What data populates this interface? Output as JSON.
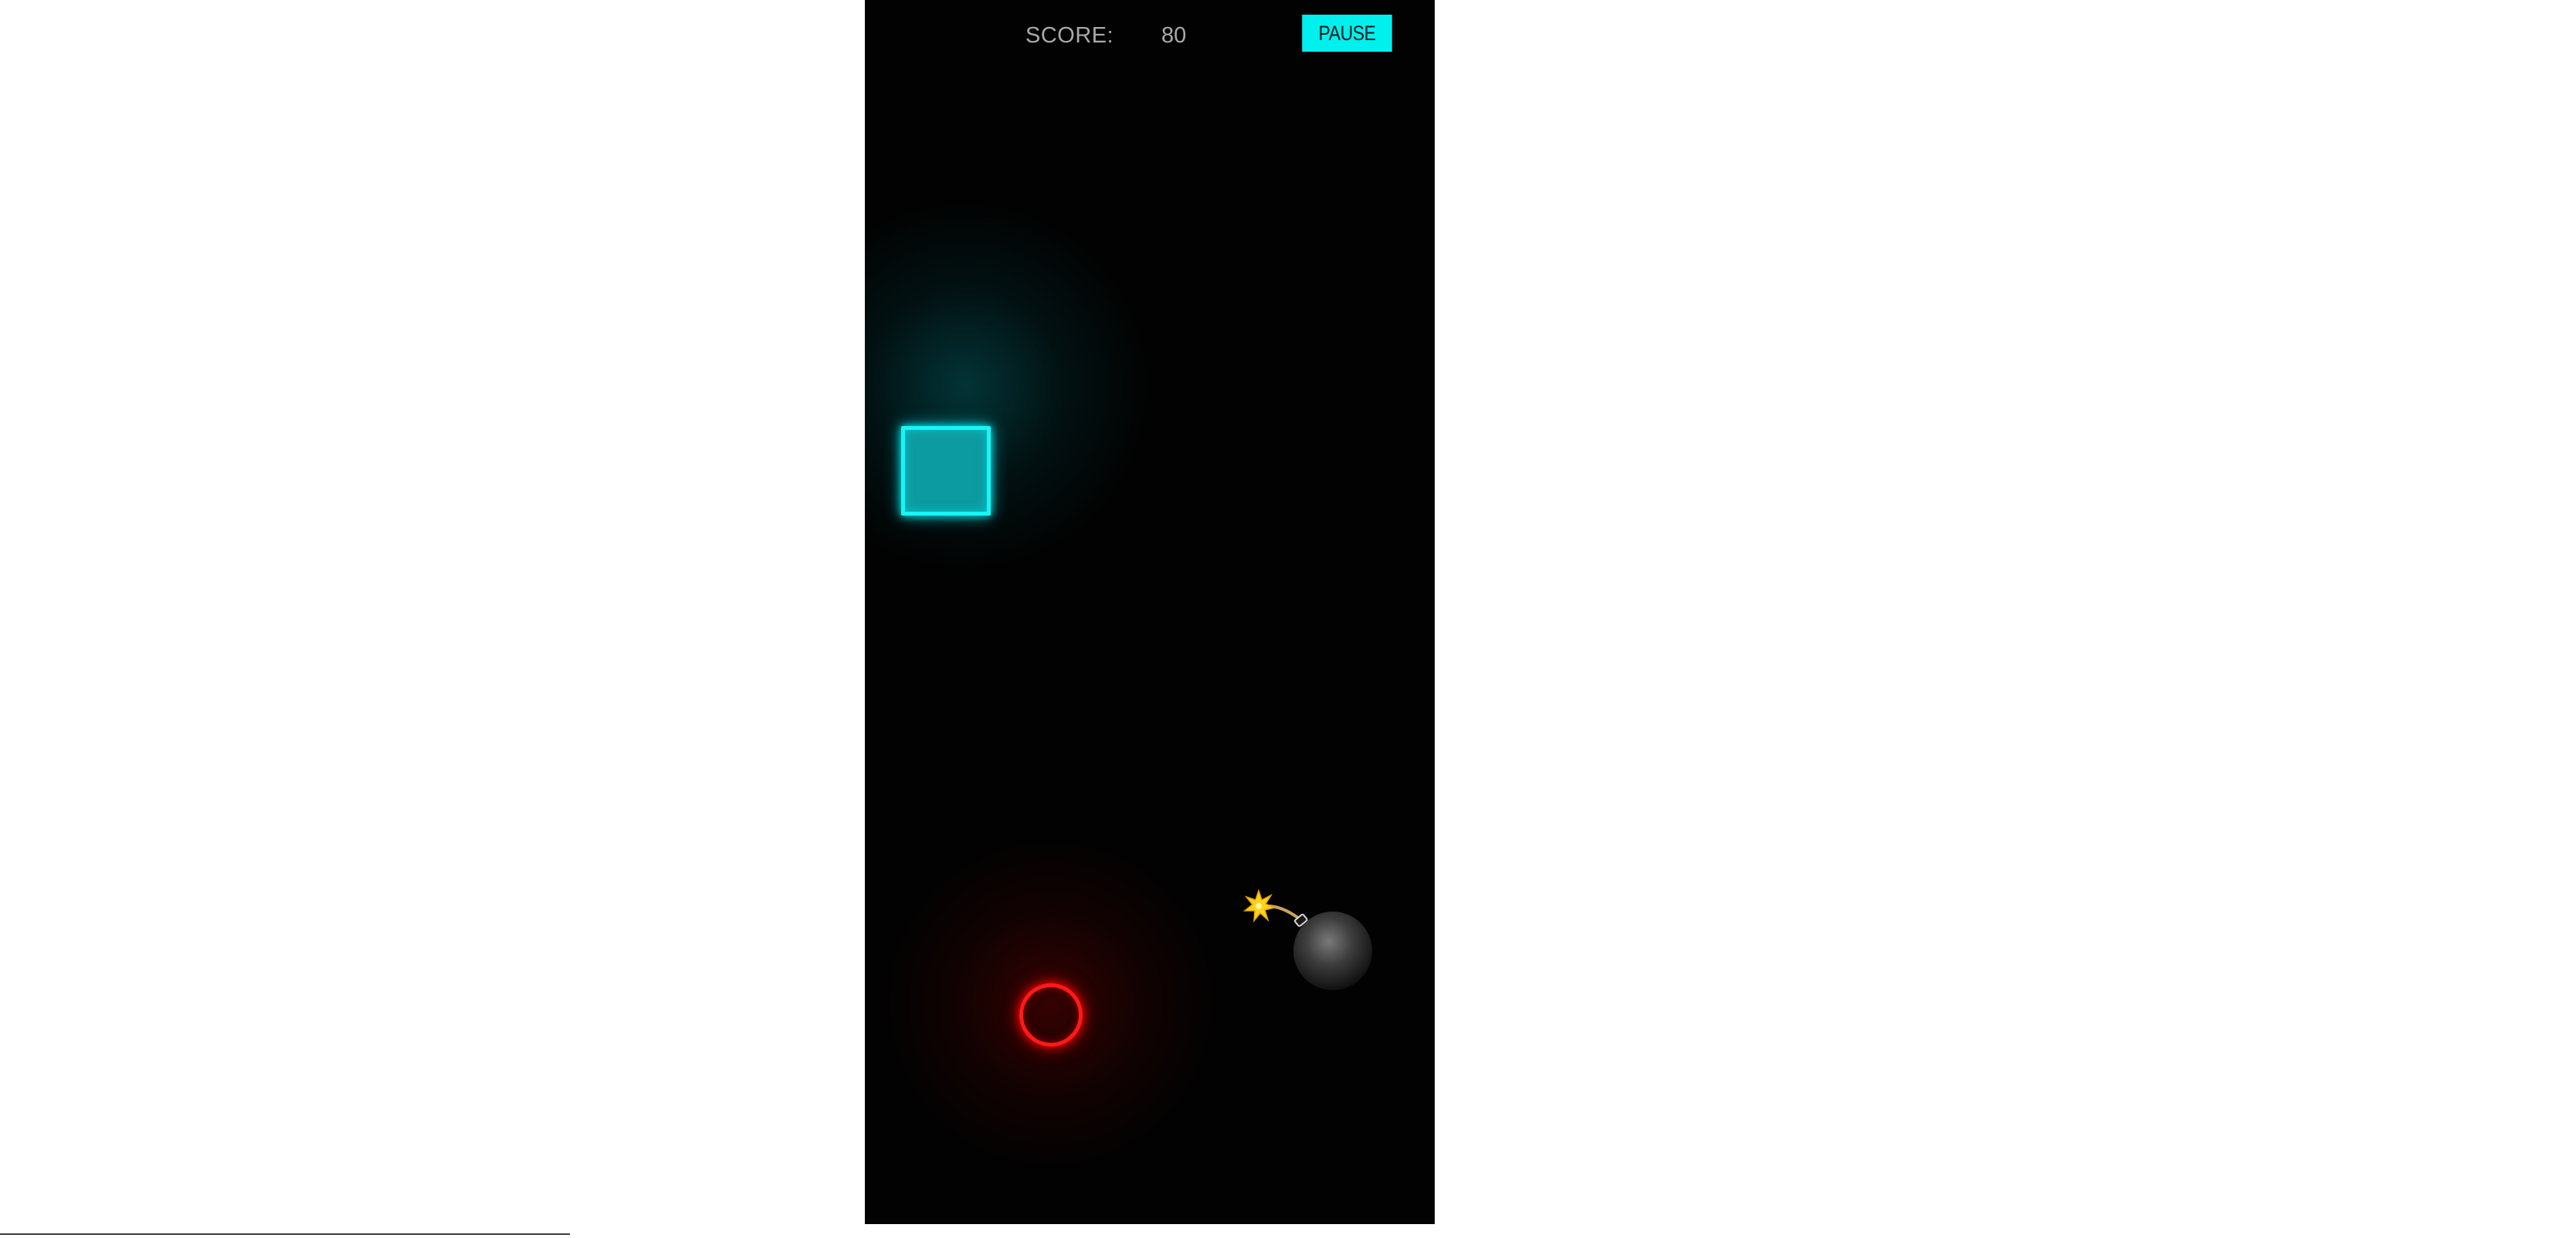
{
  "hud": {
    "score_label": "SCORE:",
    "score_value": "80",
    "pause_label": "PAUSE"
  },
  "colors": {
    "viewport_background": "#020202",
    "hud_text": "#a9a9a9",
    "pause_button": "#00f0ee",
    "player_square": "#19f5f5",
    "target_ring": "#ff1a1a",
    "bomb_body": "#4a4a4a",
    "bomb_spark": "#ffd700"
  },
  "objects": {
    "player_square_icon": "square-outline-icon",
    "target_ring_icon": "circle-outline-icon",
    "bomb_icon": "bomb-icon"
  }
}
